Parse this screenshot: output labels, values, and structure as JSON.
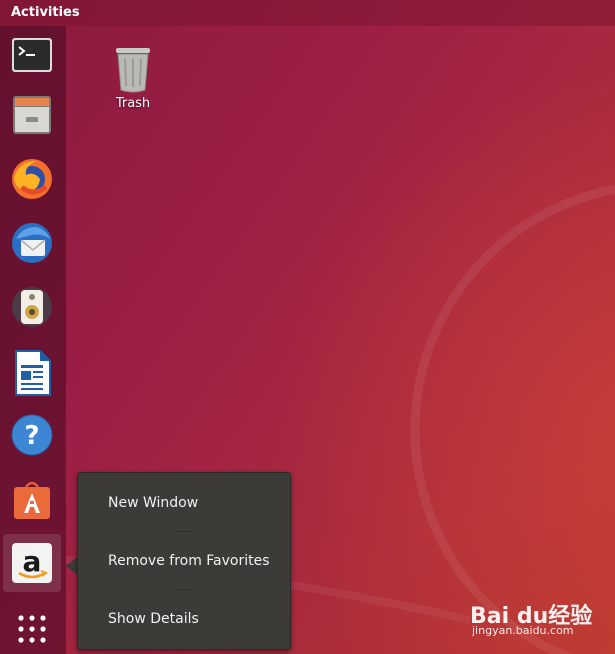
{
  "topbar": {
    "activities_label": "Activities"
  },
  "dock": {
    "items": [
      {
        "name": "Terminal",
        "icon": "terminal-icon"
      },
      {
        "name": "Files",
        "icon": "file-cabinet-icon"
      },
      {
        "name": "Firefox",
        "icon": "firefox-icon"
      },
      {
        "name": "Thunderbird",
        "icon": "thunderbird-icon"
      },
      {
        "name": "Rhythmbox",
        "icon": "speaker-icon"
      },
      {
        "name": "LibreOffice Writer",
        "icon": "writer-document-icon"
      },
      {
        "name": "Help",
        "icon": "help-icon"
      },
      {
        "name": "Ubuntu Software",
        "icon": "software-bag-icon"
      },
      {
        "name": "Amazon",
        "icon": "amazon-icon",
        "focused": true
      }
    ],
    "show_apps_icon": "app-grid-icon"
  },
  "desktop": {
    "trash_label": "Trash"
  },
  "context_menu": {
    "items": [
      "New Window",
      "Remove from Favorites",
      "Show Details"
    ]
  },
  "watermark": {
    "brand": "Bai du经验",
    "url": "jingyan.baidu.com"
  },
  "colors": {
    "menu_bg": "#3c3b37",
    "menu_text": "#f2f1f0",
    "wallpaper_start": "#8a1a3c",
    "wallpaper_end": "#b8392f"
  }
}
